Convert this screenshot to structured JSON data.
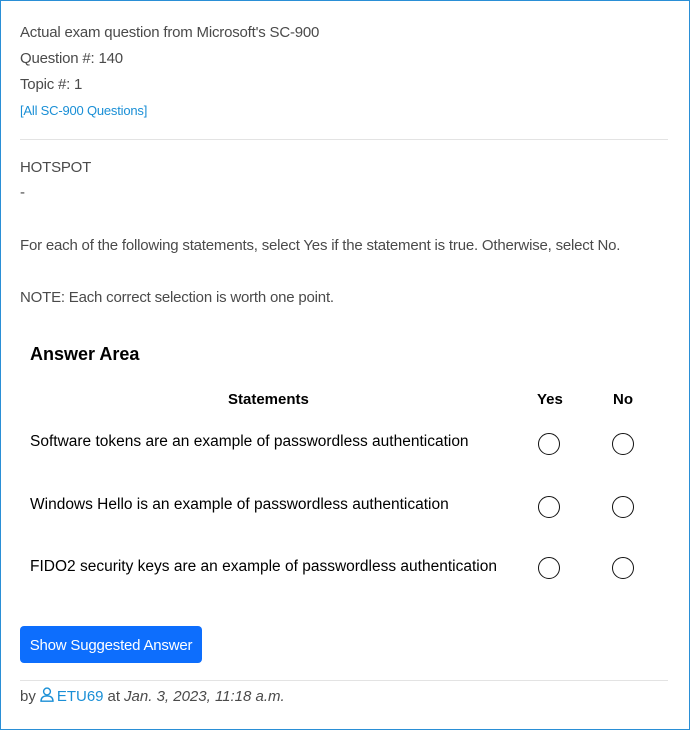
{
  "header": {
    "line1": "Actual exam question from Microsoft's SC-900",
    "line2": "Question #: 140",
    "line3": "Topic #: 1",
    "all_questions_link": "[All SC-900 Questions]"
  },
  "question": {
    "type": "HOTSPOT",
    "dash": "-",
    "instruction": "For each of the following statements, select Yes if the statement is true. Otherwise, select No.",
    "note": "NOTE: Each correct selection is worth one point."
  },
  "answer_area": {
    "title": "Answer Area",
    "columns": {
      "statements": "Statements",
      "yes": "Yes",
      "no": "No"
    },
    "rows": [
      {
        "statement": "Software tokens are an example of passwordless authentication"
      },
      {
        "statement": "Windows Hello is an example of passwordless authentication"
      },
      {
        "statement": "FIDO2 security keys are an example of passwordless authentication"
      }
    ]
  },
  "actions": {
    "show_answer": "Show Suggested Answer"
  },
  "footer": {
    "by": "by",
    "user_icon": "user-icon",
    "username": "ETU69",
    "at": "at",
    "date": "Jan. 3, 2023, 11:18 a.m."
  },
  "colors": {
    "link": "#1a8fd6",
    "button": "#0d6efd",
    "border": "#2a8fd6"
  }
}
